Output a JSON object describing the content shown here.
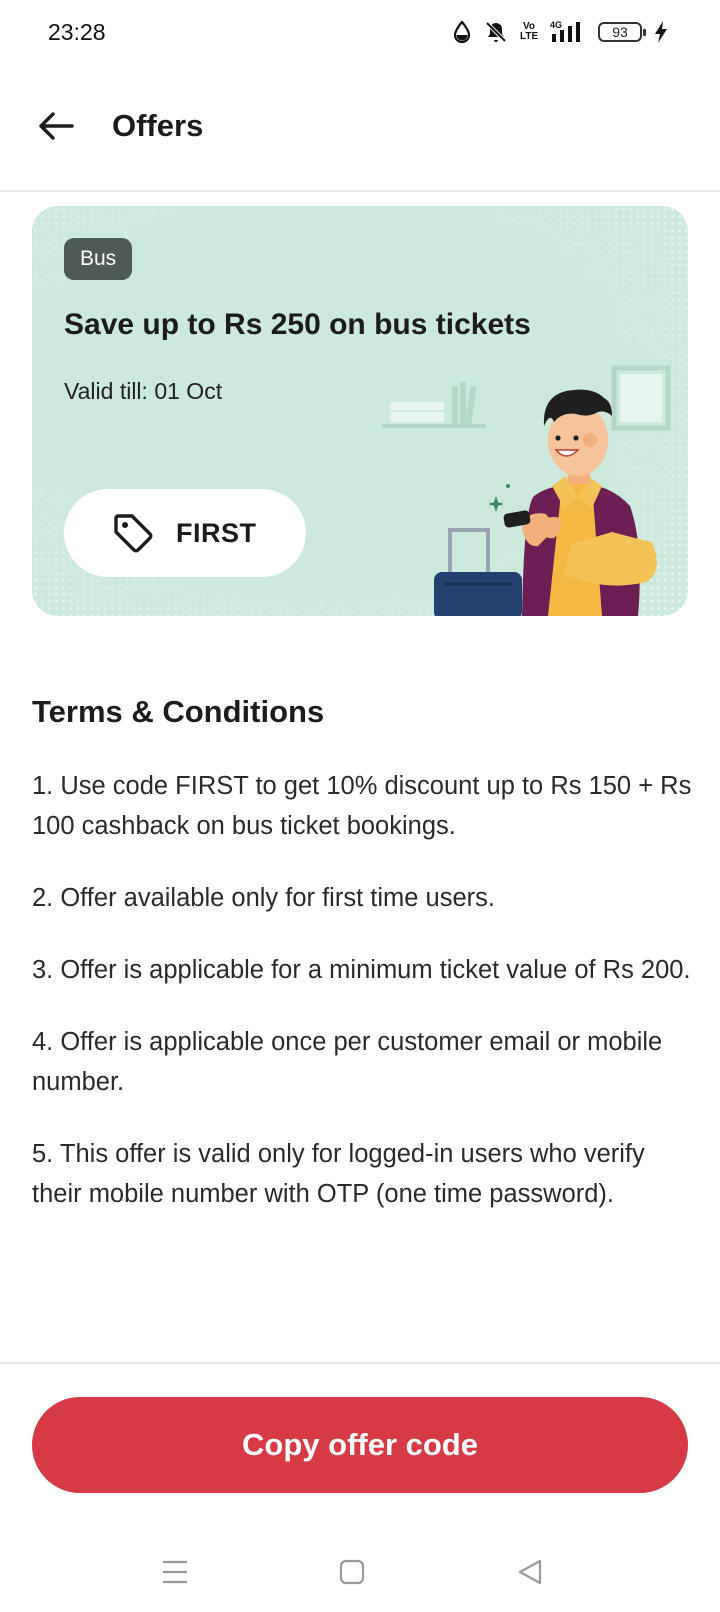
{
  "status_bar": {
    "time": "23:28",
    "volte_label": "Vo LTE",
    "network_label": "4G",
    "battery_level": "93",
    "icons": [
      "data-saver-icon",
      "mute-icon",
      "volte-icon",
      "signal-icon",
      "battery-icon",
      "charging-icon"
    ]
  },
  "header": {
    "title": "Offers",
    "back_icon": "arrow-left-icon"
  },
  "offer": {
    "category": "Bus",
    "title": "Save up to Rs 250 on bus tickets",
    "validity": "Valid till: 01 Oct",
    "code": "FIRST",
    "code_icon": "tag-icon",
    "card_color": "#cbe9dc"
  },
  "terms": {
    "title": "Terms & Conditions",
    "items": [
      "1. Use code FIRST to get 10% discount up to Rs 150 + Rs 100 cashback on bus ticket bookings.",
      "2. Offer available only for first time users.",
      "3. Offer is applicable for a minimum ticket value of Rs 200.",
      "4. Offer is applicable once per customer email or mobile number.",
      "5. This offer is valid only for logged-in users who verify their mobile number with OTP (one time password)."
    ]
  },
  "cta": {
    "label": "Copy offer code",
    "color": "#d63a44"
  },
  "nav_bar": {
    "icons": [
      "menu-icon",
      "home-icon",
      "back-triangle-icon"
    ]
  }
}
